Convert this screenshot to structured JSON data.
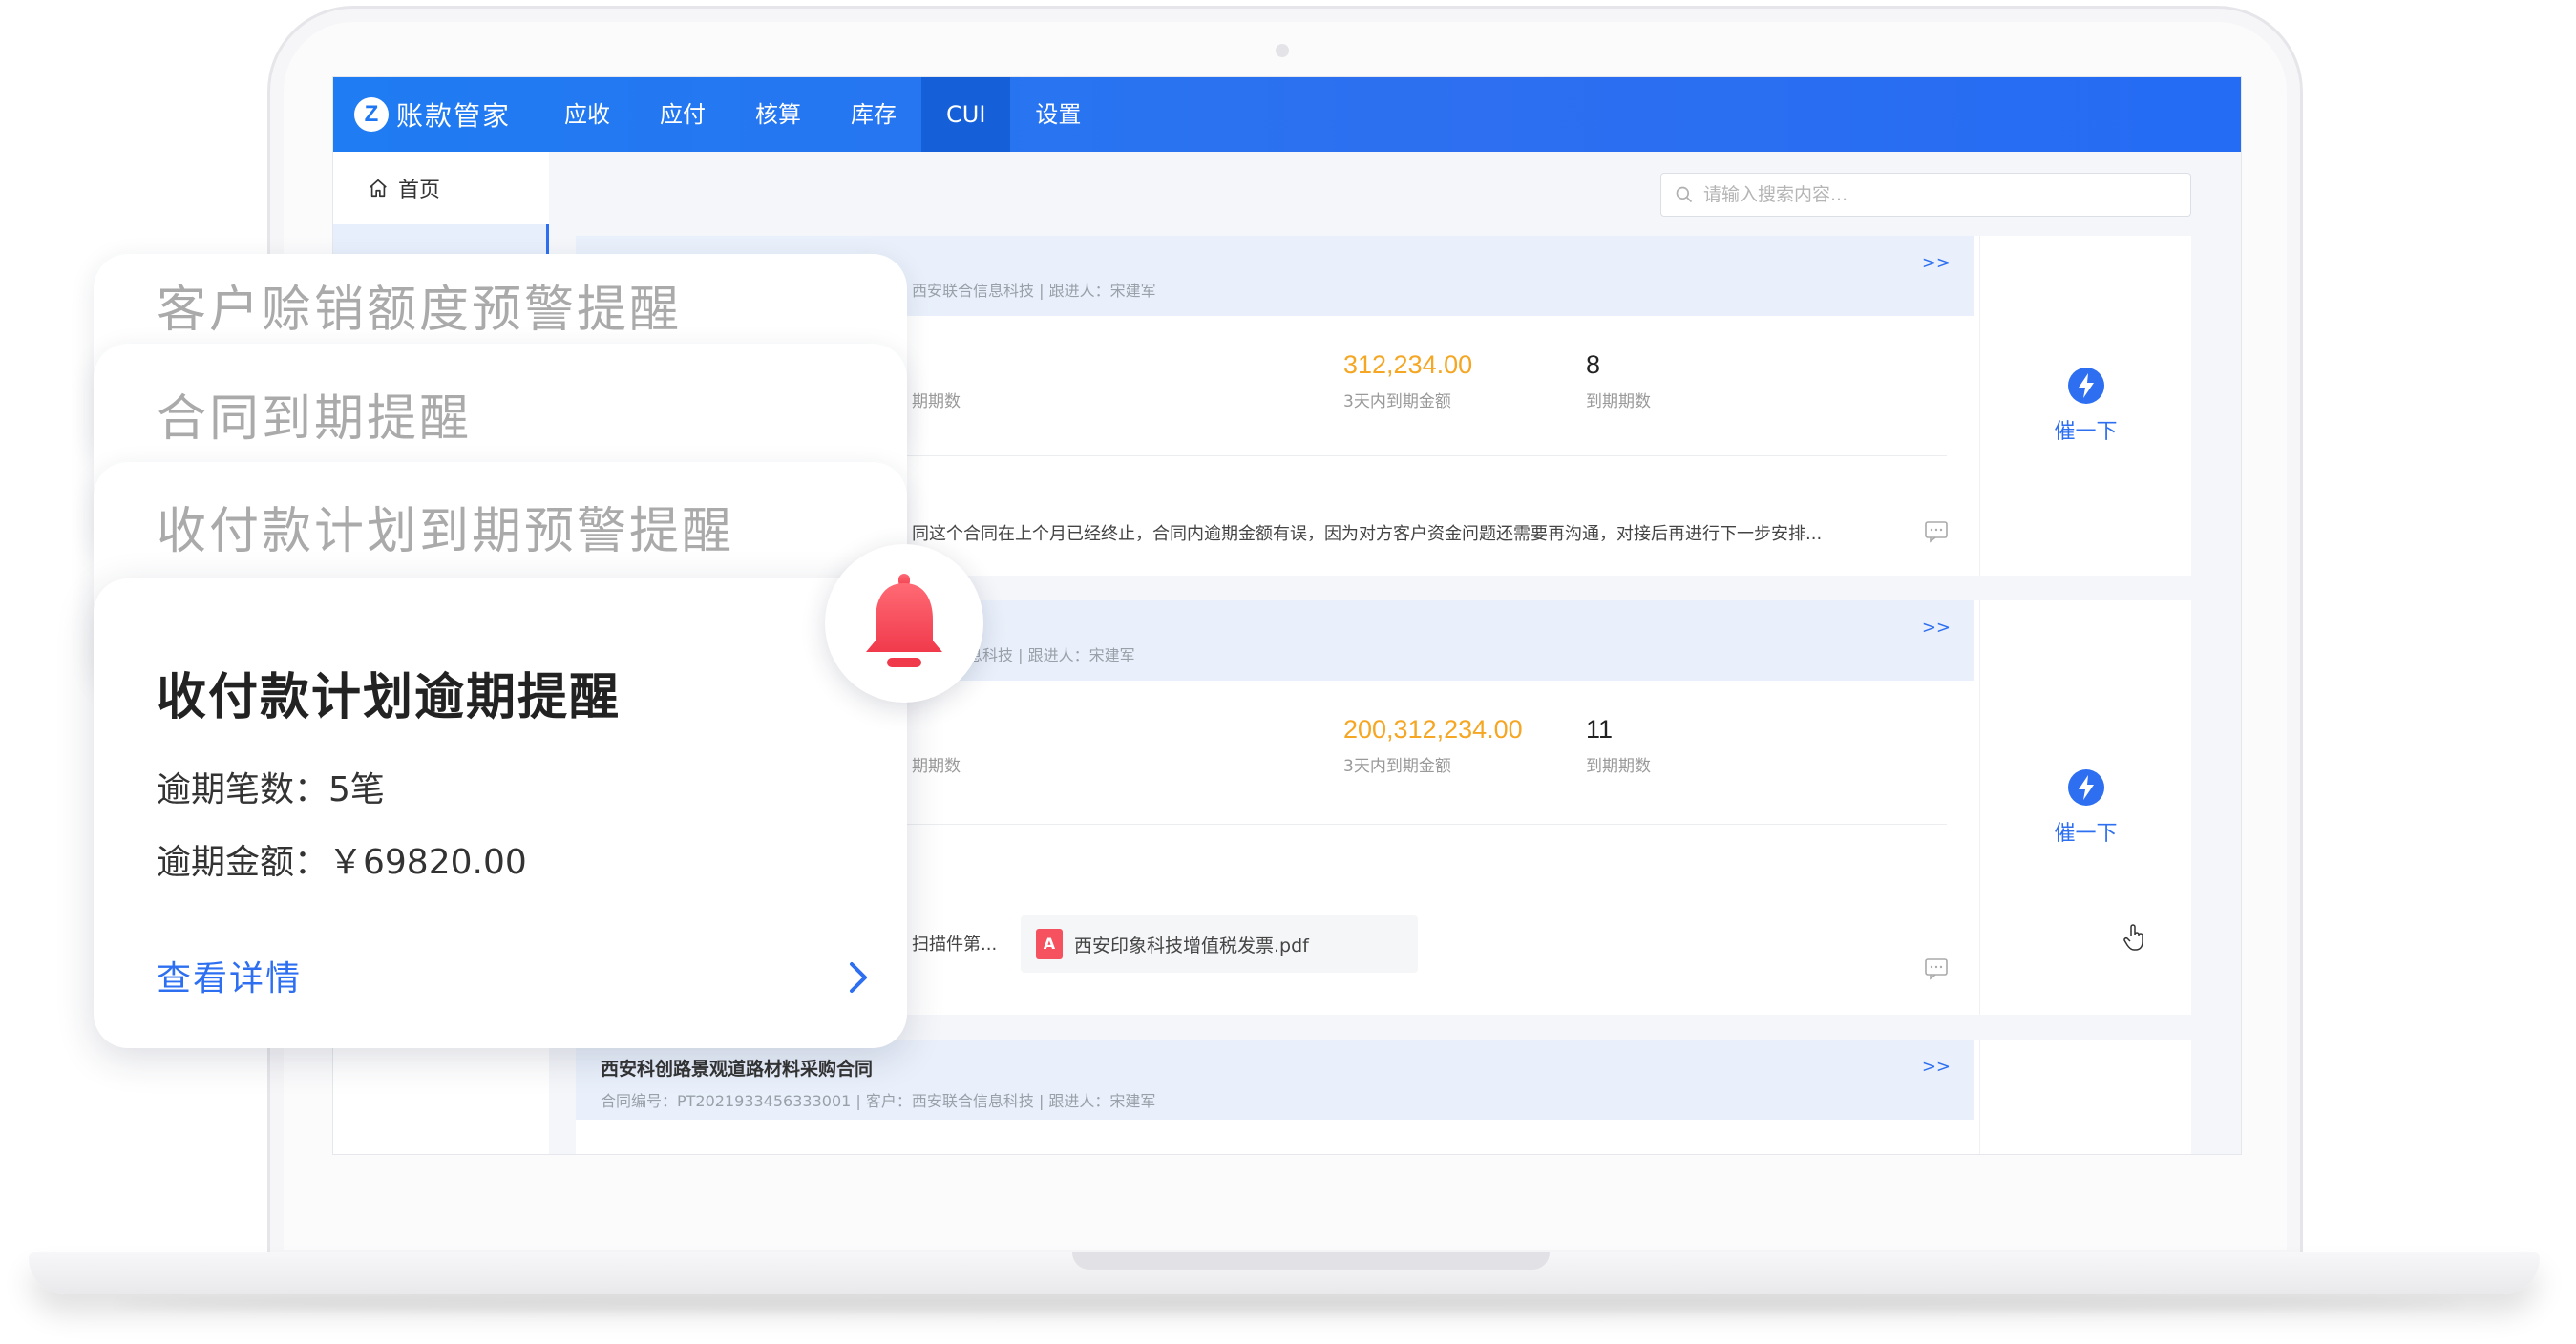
{
  "app": {
    "brand_letter": "Z",
    "brand_name": "账款管家"
  },
  "nav": {
    "items": [
      {
        "label": "应收"
      },
      {
        "label": "应付"
      },
      {
        "label": "核算"
      },
      {
        "label": "库存"
      },
      {
        "label": "CUI",
        "active": true
      },
      {
        "label": "设置"
      }
    ]
  },
  "sidebar": {
    "home_label": "首页"
  },
  "search": {
    "placeholder": "请输入搜索内容..."
  },
  "cards": [
    {
      "meta": "西安联合信息科技 | 跟进人：宋建军",
      "more": ">>",
      "metric1_label": "期期数",
      "amount": "312,234.00",
      "amount_label": "3天内到期金额",
      "count": "8",
      "count_label": "到期期数",
      "remark": "同这个合同在上个月已经终止，合同内逾期金额有误，因为对方客户资金问题还需要再沟通，对接后再进行下一步安排...",
      "urge_label": "催一下"
    },
    {
      "meta": "息科技 | 跟进人：宋建军",
      "more": ">>",
      "metric1_label": "期期数",
      "amount": "200,312,234.00",
      "amount_label": "3天内到期金额",
      "count": "11",
      "count_label": "到期期数",
      "file1": "扫描件第...",
      "file2": "西安印象科技增值税发票.pdf",
      "pdf_icon_text": "A",
      "urge_label": "催一下"
    },
    {
      "title": "西安科创路景观道路材料采购合同",
      "meta": "合同编号：PT2021933456333001 | 客户：西安联合信息科技 | 跟进人：宋建军",
      "more": ">>"
    }
  ],
  "notifications": {
    "stack": [
      {
        "title": "客户赊销额度预警提醒"
      },
      {
        "title": "合同到期提醒"
      },
      {
        "title": "收付款计划到期预警提醒"
      }
    ],
    "main": {
      "title": "收付款计划逾期提醒",
      "overdue_count": "逾期笔数：5笔",
      "overdue_amount": "逾期金额：￥69820.00",
      "detail_link": "查看详情"
    }
  },
  "colors": {
    "primary": "#2d6ff0",
    "amount": "#f5a623",
    "bell": "#f5515f"
  },
  "icons": [
    "home-icon",
    "search-icon",
    "bolt-icon",
    "comment-icon",
    "pdf-icon",
    "bell-icon",
    "chevron-right-icon",
    "hand-cursor-icon"
  ]
}
